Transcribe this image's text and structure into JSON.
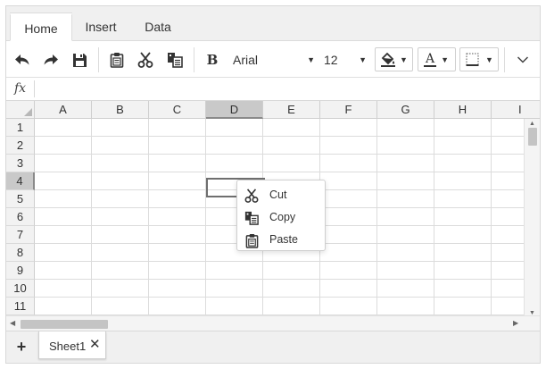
{
  "tabs": [
    {
      "label": "Home",
      "active": true
    },
    {
      "label": "Insert",
      "active": false
    },
    {
      "label": "Data",
      "active": false
    }
  ],
  "toolbar": {
    "bold_label": "B",
    "font_family": "Arial",
    "font_size": "12",
    "font_color_label": "A",
    "dropdown_caret": "▼",
    "icons": [
      "undo-icon",
      "redo-icon",
      "save-icon",
      "paste-icon",
      "cut-icon",
      "copy-icon",
      "bold-icon",
      "fill-color-icon",
      "font-color-icon",
      "border-icon",
      "collapse-chevron-icon"
    ]
  },
  "formula_bar": {
    "label": "fx",
    "value": ""
  },
  "grid": {
    "columns": [
      "A",
      "B",
      "C",
      "D",
      "E",
      "F",
      "G",
      "H",
      "I"
    ],
    "rows": [
      "1",
      "2",
      "3",
      "4",
      "5",
      "6",
      "7",
      "8",
      "9",
      "10",
      "11"
    ],
    "selected_column": "D",
    "selected_row": "4",
    "active_cell": "D4"
  },
  "context_menu": {
    "items": [
      {
        "label": "Cut",
        "icon": "cut-icon"
      },
      {
        "label": "Copy",
        "icon": "copy-icon"
      },
      {
        "label": "Paste",
        "icon": "paste-icon"
      }
    ]
  },
  "sheet_tabs": {
    "add_label": "+",
    "close_label": "✕",
    "sheets": [
      {
        "name": "Sheet1",
        "active": true
      }
    ]
  },
  "colors": {
    "header_bg": "#f2f2f2",
    "selected_header_bg": "#c9c9c9",
    "gridline": "#dcdcdc",
    "active_cell_border": "#6f6f6f"
  }
}
